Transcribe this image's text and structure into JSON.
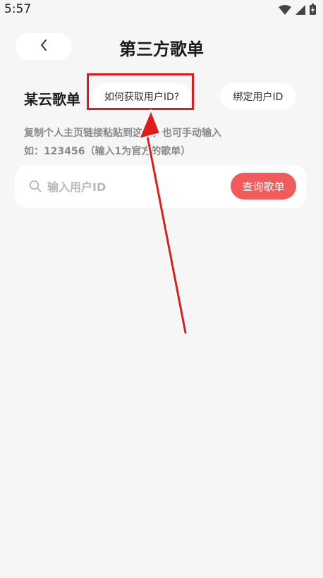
{
  "status_bar": {
    "time": "5:57",
    "icons": [
      "wifi-icon",
      "signal-icon",
      "battery-charging-icon"
    ]
  },
  "header": {
    "back_icon": "chevron-left-icon",
    "title": "第三方歌单"
  },
  "section": {
    "label": "某云歌单",
    "how_button": "如何获取用户ID?",
    "bind_button": "绑定用户ID"
  },
  "hint": {
    "line1": "复制个人主页链接粘贴到这里，也可手动输入",
    "line2": "如：123456（输入1为官方的歌单）"
  },
  "search": {
    "icon": "search-icon",
    "placeholder": "输入用户ID",
    "value": "",
    "button_label": "查询歌单"
  },
  "colors": {
    "accent": "#f15b5b",
    "annotation": "#e01c1c",
    "background": "#f6f6f6"
  }
}
